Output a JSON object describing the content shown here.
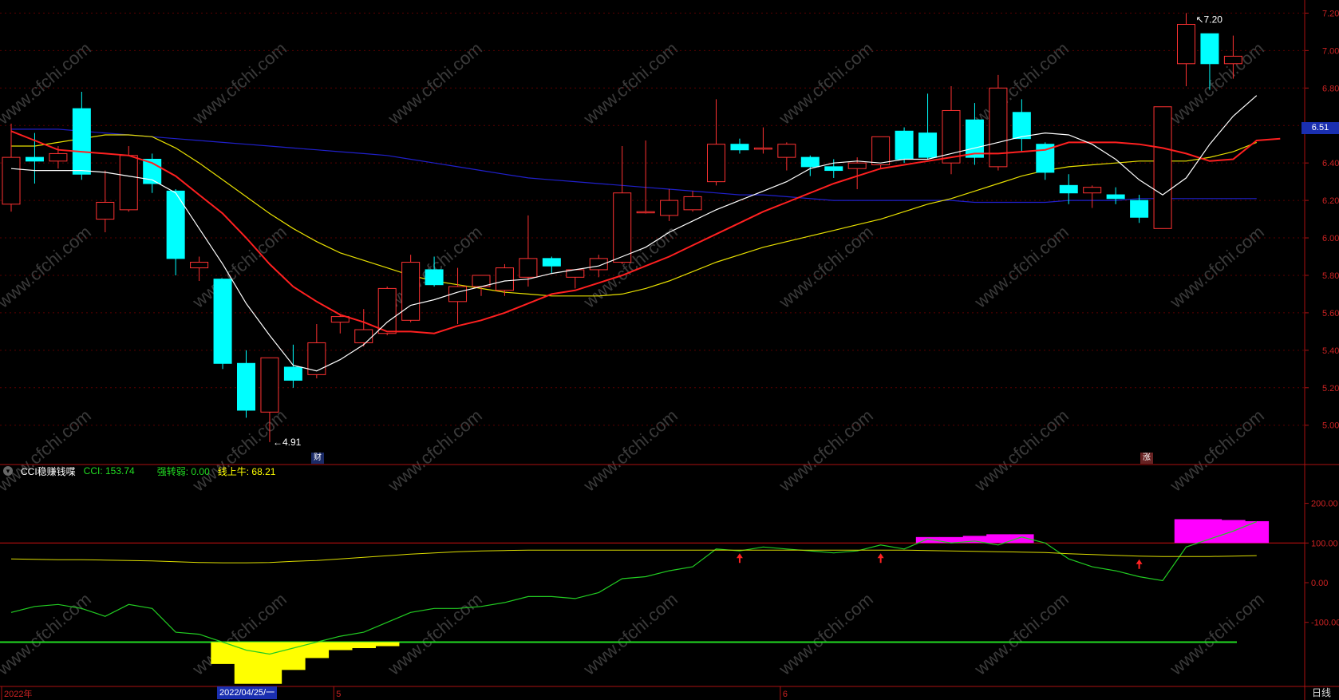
{
  "chart_data": [
    {
      "type": "candlestick",
      "ylim": [
        4.8,
        7.25
      ],
      "yticks": [
        "5.00",
        "5.20",
        "5.40",
        "5.60",
        "5.80",
        "6.00",
        "6.20",
        "6.40",
        "6.60",
        "6.80",
        "7.00",
        "7.20"
      ],
      "annotations": {
        "high": "7.20",
        "low": "4.91",
        "current_price": "6.51"
      },
      "markers": {
        "cai": "财",
        "zhang": "涨"
      },
      "candles": [
        {
          "o": 6.18,
          "h": 6.61,
          "l": 6.14,
          "c": 6.43
        },
        {
          "o": 6.43,
          "h": 6.56,
          "l": 6.29,
          "c": 6.41
        },
        {
          "o": 6.41,
          "h": 6.49,
          "l": 6.37,
          "c": 6.45
        },
        {
          "o": 6.69,
          "h": 6.78,
          "l": 6.31,
          "c": 6.34
        },
        {
          "o": 6.1,
          "h": 6.36,
          "l": 6.03,
          "c": 6.19
        },
        {
          "o": 6.15,
          "h": 6.49,
          "l": 6.14,
          "c": 6.44
        },
        {
          "o": 6.42,
          "h": 6.45,
          "l": 6.24,
          "c": 6.29
        },
        {
          "o": 6.25,
          "h": 6.26,
          "l": 5.8,
          "c": 5.89
        },
        {
          "o": 5.84,
          "h": 5.9,
          "l": 5.77,
          "c": 5.87
        },
        {
          "o": 5.78,
          "h": 5.78,
          "l": 5.3,
          "c": 5.33
        },
        {
          "o": 5.33,
          "h": 5.4,
          "l": 5.04,
          "c": 5.08
        },
        {
          "o": 5.07,
          "h": 5.36,
          "l": 4.91,
          "c": 5.36
        },
        {
          "o": 5.31,
          "h": 5.43,
          "l": 5.2,
          "c": 5.24
        },
        {
          "o": 5.27,
          "h": 5.54,
          "l": 5.25,
          "c": 5.44
        },
        {
          "o": 5.55,
          "h": 5.59,
          "l": 5.49,
          "c": 5.58
        },
        {
          "o": 5.44,
          "h": 5.62,
          "l": 5.42,
          "c": 5.51
        },
        {
          "o": 5.49,
          "h": 5.74,
          "l": 5.48,
          "c": 5.73
        },
        {
          "o": 5.56,
          "h": 5.91,
          "l": 5.55,
          "c": 5.87
        },
        {
          "o": 5.83,
          "h": 5.9,
          "l": 5.74,
          "c": 5.75
        },
        {
          "o": 5.66,
          "h": 5.84,
          "l": 5.54,
          "c": 5.74
        },
        {
          "o": 5.74,
          "h": 5.79,
          "l": 5.69,
          "c": 5.8
        },
        {
          "o": 5.72,
          "h": 5.86,
          "l": 5.69,
          "c": 5.84
        },
        {
          "o": 5.79,
          "h": 6.12,
          "l": 5.74,
          "c": 5.89
        },
        {
          "o": 5.89,
          "h": 5.9,
          "l": 5.81,
          "c": 5.85
        },
        {
          "o": 5.79,
          "h": 5.82,
          "l": 5.73,
          "c": 5.83
        },
        {
          "o": 5.83,
          "h": 5.91,
          "l": 5.79,
          "c": 5.89
        },
        {
          "o": 5.87,
          "h": 6.49,
          "l": 5.86,
          "c": 6.24
        },
        {
          "o": 6.14,
          "h": 6.52,
          "l": 6.13,
          "c": 6.14
        },
        {
          "o": 6.12,
          "h": 6.26,
          "l": 6.09,
          "c": 6.2
        },
        {
          "o": 6.15,
          "h": 6.25,
          "l": 6.14,
          "c": 6.22
        },
        {
          "o": 6.3,
          "h": 6.74,
          "l": 6.28,
          "c": 6.5
        },
        {
          "o": 6.5,
          "h": 6.53,
          "l": 6.45,
          "c": 6.47
        },
        {
          "o": 6.48,
          "h": 6.59,
          "l": 6.45,
          "c": 6.48
        },
        {
          "o": 6.43,
          "h": 6.51,
          "l": 6.36,
          "c": 6.5
        },
        {
          "o": 6.43,
          "h": 6.44,
          "l": 6.33,
          "c": 6.38
        },
        {
          "o": 6.38,
          "h": 6.42,
          "l": 6.32,
          "c": 6.36
        },
        {
          "o": 6.37,
          "h": 6.43,
          "l": 6.26,
          "c": 6.4
        },
        {
          "o": 6.39,
          "h": 6.49,
          "l": 6.37,
          "c": 6.54
        },
        {
          "o": 6.57,
          "h": 6.59,
          "l": 6.4,
          "c": 6.42
        },
        {
          "o": 6.56,
          "h": 6.77,
          "l": 6.42,
          "c": 6.43
        },
        {
          "o": 6.4,
          "h": 6.81,
          "l": 6.34,
          "c": 6.68
        },
        {
          "o": 6.63,
          "h": 6.72,
          "l": 6.39,
          "c": 6.43
        },
        {
          "o": 6.38,
          "h": 6.87,
          "l": 6.36,
          "c": 6.8
        },
        {
          "o": 6.67,
          "h": 6.74,
          "l": 6.46,
          "c": 6.53
        },
        {
          "o": 6.5,
          "h": 6.51,
          "l": 6.31,
          "c": 6.35
        },
        {
          "o": 6.28,
          "h": 6.34,
          "l": 6.18,
          "c": 6.24
        },
        {
          "o": 6.24,
          "h": 6.28,
          "l": 6.16,
          "c": 6.27
        },
        {
          "o": 6.23,
          "h": 6.27,
          "l": 6.18,
          "c": 6.21
        },
        {
          "o": 6.2,
          "h": 6.23,
          "l": 6.08,
          "c": 6.11
        },
        {
          "o": 6.05,
          "h": 6.7,
          "l": 6.05,
          "c": 6.7
        },
        {
          "o": 6.93,
          "h": 7.2,
          "l": 6.81,
          "c": 7.14
        },
        {
          "o": 7.09,
          "h": 7.09,
          "l": 6.79,
          "c": 6.93
        },
        {
          "o": 6.93,
          "h": 7.08,
          "l": 6.85,
          "c": 6.97
        }
      ],
      "ma5": [
        6.37,
        6.36,
        6.36,
        6.36,
        6.35,
        6.33,
        6.31,
        6.24,
        6.05,
        5.86,
        5.65,
        5.48,
        5.32,
        5.29,
        5.35,
        5.43,
        5.55,
        5.64,
        5.67,
        5.71,
        5.74,
        5.77,
        5.78,
        5.81,
        5.83,
        5.85,
        5.9,
        5.95,
        6.03,
        6.09,
        6.15,
        6.2,
        6.25,
        6.3,
        6.37,
        6.4,
        6.41,
        6.4,
        6.42,
        6.42,
        6.45,
        6.48,
        6.51,
        6.54,
        6.56,
        6.55,
        6.5,
        6.42,
        6.31,
        6.23,
        6.32,
        6.5,
        6.65,
        6.76
      ],
      "ma10": [
        6.57,
        6.52,
        6.47,
        6.46,
        6.45,
        6.44,
        6.4,
        6.33,
        6.23,
        6.13,
        6.0,
        5.86,
        5.74,
        5.66,
        5.59,
        5.55,
        5.5,
        5.5,
        5.49,
        5.53,
        5.56,
        5.6,
        5.65,
        5.7,
        5.72,
        5.76,
        5.8,
        5.85,
        5.9,
        5.96,
        6.02,
        6.08,
        6.14,
        6.19,
        6.24,
        6.29,
        6.33,
        6.37,
        6.39,
        6.41,
        6.43,
        6.45,
        6.45,
        6.46,
        6.47,
        6.51,
        6.51,
        6.51,
        6.5,
        6.48,
        6.45,
        6.41,
        6.42,
        6.52,
        6.53
      ],
      "ma20": [
        6.49,
        6.49,
        6.51,
        6.53,
        6.55,
        6.55,
        6.54,
        6.48,
        6.4,
        6.31,
        6.22,
        6.13,
        6.05,
        5.98,
        5.92,
        5.88,
        5.84,
        5.8,
        5.77,
        5.75,
        5.73,
        5.71,
        5.7,
        5.69,
        5.69,
        5.69,
        5.7,
        5.73,
        5.77,
        5.82,
        5.87,
        5.91,
        5.95,
        5.98,
        6.01,
        6.04,
        6.07,
        6.1,
        6.14,
        6.18,
        6.21,
        6.25,
        6.29,
        6.33,
        6.36,
        6.38,
        6.39,
        6.4,
        6.41,
        6.41,
        6.41,
        6.43,
        6.46,
        6.51
      ],
      "ma60": [
        6.58,
        6.58,
        6.58,
        6.57,
        6.56,
        6.55,
        6.54,
        6.53,
        6.52,
        6.51,
        6.5,
        6.49,
        6.48,
        6.47,
        6.46,
        6.45,
        6.44,
        6.42,
        6.4,
        6.38,
        6.36,
        6.34,
        6.32,
        6.31,
        6.3,
        6.29,
        6.28,
        6.27,
        6.26,
        6.25,
        6.24,
        6.23,
        6.23,
        6.22,
        6.21,
        6.2,
        6.2,
        6.2,
        6.2,
        6.2,
        6.2,
        6.19,
        6.19,
        6.19,
        6.19,
        6.2,
        6.2,
        6.2,
        6.21,
        6.21,
        6.21,
        6.21,
        6.21,
        6.21
      ]
    },
    {
      "type": "line",
      "indicator_name": "CCI稳赚钱喋",
      "legend": {
        "cci": "CCI: 153.74",
        "qiangzhuanruo": "强转弱: 0.00",
        "xianshangniu": "线上牛: 68.21"
      },
      "ylim": [
        -260,
        260
      ],
      "yticks": [
        "200.00",
        "100.00",
        "0.00",
        "-100.00"
      ],
      "hlines": [
        100,
        -150
      ],
      "cci": [
        -75,
        -60,
        -55,
        -65,
        -85,
        -55,
        -65,
        -125,
        -130,
        -150,
        -170,
        -180,
        -165,
        -150,
        -135,
        -125,
        -100,
        -75,
        -65,
        -65,
        -60,
        -50,
        -35,
        -35,
        -40,
        -25,
        10,
        15,
        30,
        40,
        85,
        80,
        90,
        85,
        80,
        75,
        80,
        95,
        85,
        110,
        100,
        105,
        95,
        115,
        100,
        60,
        40,
        30,
        15,
        5,
        90,
        110,
        130,
        153.74
      ],
      "xianshangniu": [
        60,
        59,
        58,
        58,
        57,
        56,
        55,
        53,
        51,
        50,
        50,
        51,
        54,
        56,
        60,
        64,
        68,
        72,
        75,
        78,
        80,
        81,
        82,
        82,
        82,
        82,
        82,
        82,
        82,
        82,
        82,
        82,
        82,
        82,
        82,
        82,
        82,
        82,
        82,
        81,
        80,
        79,
        78,
        77,
        76,
        73,
        71,
        69,
        67,
        66,
        66,
        66,
        67,
        68.21
      ],
      "yellow_bars": [
        0,
        0,
        0,
        0,
        0,
        0,
        0,
        0,
        0,
        -205,
        -255,
        -255,
        -220,
        -190,
        -170,
        -165,
        -160,
        0,
        0,
        0,
        0,
        0,
        0,
        0,
        0,
        0,
        0,
        0,
        0,
        0,
        0,
        0,
        0,
        0,
        0,
        0,
        0,
        0,
        0,
        0,
        0,
        0,
        0,
        0,
        0,
        0,
        0,
        0,
        0,
        0,
        0,
        0,
        0,
        0
      ],
      "magenta_bars": [
        0,
        0,
        0,
        0,
        0,
        0,
        0,
        0,
        0,
        0,
        0,
        0,
        0,
        0,
        0,
        0,
        0,
        0,
        0,
        0,
        0,
        0,
        0,
        0,
        0,
        0,
        0,
        0,
        0,
        0,
        0,
        0,
        0,
        0,
        0,
        0,
        0,
        0,
        0,
        115,
        115,
        118,
        122,
        122,
        0,
        0,
        0,
        0,
        0,
        0,
        160,
        160,
        158,
        155
      ],
      "arrows": [
        31,
        37,
        48
      ]
    }
  ],
  "x_axis": {
    "labels": [
      {
        "text": "2022年",
        "i": 0
      },
      {
        "text": "5",
        "i": 14
      },
      {
        "text": "6",
        "i": 33
      }
    ],
    "cursor_date": "2022/04/25/一"
  },
  "period_label": "日线",
  "watermark": "www.cfchi.com",
  "colors": {
    "up": "#ff3232",
    "down": "#00ffff",
    "ma5": "#ffffff",
    "ma10": "#ff2020",
    "ma20": "#e8e000",
    "ma60": "#2020cc",
    "cci": "#22cc22",
    "xianshangniu": "#dddd00",
    "yellow_bars": "#ffff00",
    "magenta_bars": "#ff00ff",
    "axis": "#aa1111"
  }
}
